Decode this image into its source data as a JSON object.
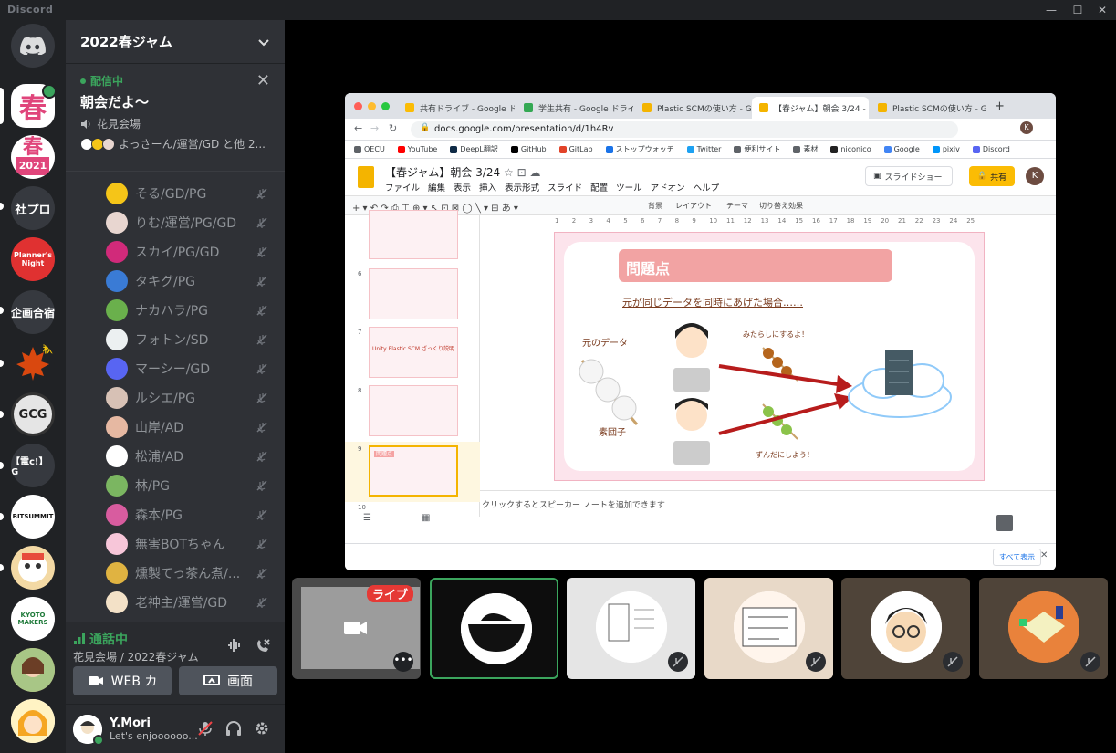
{
  "app": {
    "name": "Discord"
  },
  "guild": {
    "name": "2022春ジャム"
  },
  "servers": [
    {
      "label": "春"
    },
    {
      "label": "春"
    },
    {
      "label": "2021"
    },
    {
      "label": "社プロ"
    },
    {
      "label": "Planner's Night"
    },
    {
      "label": "企画合宿"
    },
    {
      "label": "秋"
    },
    {
      "label": "GCG"
    },
    {
      "label": "【電c!】G"
    },
    {
      "label": "BITSUMMIT"
    },
    {
      "label": "KYOTO MAKERS"
    }
  ],
  "stream": {
    "status": "配信中",
    "title": "朝会だよ～",
    "channel": "花見会場",
    "viewers": "よっさーん/運営/GD と他 2..."
  },
  "members": [
    {
      "name": "そる/GD/PG",
      "color": "#f5c518"
    },
    {
      "name": "りむ/運営/PG/GD",
      "color": "#e8d6d0"
    },
    {
      "name": "スカイ/PG/GD",
      "color": "#d12a7a"
    },
    {
      "name": "タキグ/PG",
      "color": "#3a7bd5"
    },
    {
      "name": "ナカハラ/PG",
      "color": "#6ab04c"
    },
    {
      "name": "フォトン/SD",
      "color": "#ecf0f1"
    },
    {
      "name": "マーシー/GD",
      "color": "#5865f2"
    },
    {
      "name": "ルシエ/PG",
      "color": "#d7c1b5"
    },
    {
      "name": "山岸/AD",
      "color": "#e6b8a2"
    },
    {
      "name": "松浦/AD",
      "color": "#ffffff"
    },
    {
      "name": "林/PG",
      "color": "#7bb661"
    },
    {
      "name": "森本/PG",
      "color": "#d85c9f"
    },
    {
      "name": "無害BOTちゃん",
      "color": "#f7c6d9"
    },
    {
      "name": "燻製てっ茶ん煮/...",
      "color": "#e0b341"
    },
    {
      "name": "老神主/運営/GD",
      "color": "#f3e1c7"
    }
  ],
  "voice": {
    "status": "通話中",
    "location": "花見会場 / 2022春ジャム",
    "camera_label": "WEB カ",
    "screen_label": "画面"
  },
  "user": {
    "name": "Y.Mori",
    "status_text": "Let's enjoooooo..."
  },
  "browser": {
    "tabs": [
      "共有ドライブ - Google ド",
      "学生共有 - Google ドライ",
      "Plastic SCMの使い方 - Go",
      "【春ジャム】朝会 3/24 - G",
      "Plastic SCMの使い方 - Go"
    ],
    "url": "docs.google.com/presentation/d/1h4Rv",
    "bookmarks": [
      "OECU",
      "YouTube",
      "DeepL翻訳",
      "GitHub",
      "GitLab",
      "ストップウォッチ",
      "Twitter",
      "便利サイト",
      "素材",
      "niconico",
      "Google",
      "pixiv",
      "Discord"
    ],
    "doc_title": "【春ジャム】朝会 3/24",
    "menu": [
      "ファイル",
      "編集",
      "表示",
      "挿入",
      "表示形式",
      "スライド",
      "配置",
      "ツール",
      "アドオン",
      "ヘルプ"
    ],
    "slideshow_label": "スライドショー",
    "share_label": "共有",
    "avatar_letter": "K",
    "toolbar": [
      "背景",
      "レイアウト",
      "テーマ",
      "切り替え効果"
    ],
    "notes_placeholder": "クリックするとスピーカー ノートを追加できます",
    "show_all": "すべて表示"
  },
  "slide": {
    "heading": "問題点",
    "subtitle": "元が同じデータを同時にあげた場合……",
    "label_source": "元のデータ",
    "label_dango": "素団子",
    "label_top": "みたらしにするよ！",
    "label_bottom": "ずんだにしよう！"
  },
  "thumbnails": [
    {
      "num": "6",
      "text": ""
    },
    {
      "num": "7",
      "text": "Unity Plastic SCM ざっくり説明"
    },
    {
      "num": "8",
      "text": ""
    },
    {
      "num": "9",
      "text": "問題点"
    },
    {
      "num": "10",
      "text": ""
    }
  ],
  "ruler": [
    "1",
    "2",
    "3",
    "4",
    "5",
    "6",
    "7",
    "8",
    "9",
    "10",
    "11",
    "12",
    "13",
    "14",
    "15",
    "16",
    "17",
    "18",
    "19",
    "20",
    "21",
    "22",
    "23",
    "24",
    "25"
  ],
  "tiles": [
    {
      "label": "ライブ"
    }
  ]
}
